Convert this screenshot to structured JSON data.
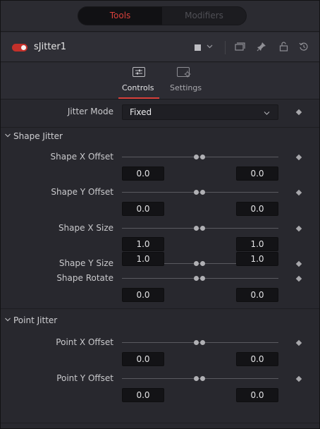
{
  "tabs": {
    "tools": "Tools",
    "modifiers": "Modifiers"
  },
  "node": {
    "name": "sJitter1",
    "toggle_color": "#c3302a"
  },
  "header_icons": [
    "color-square-icon",
    "chevron-down-icon",
    "version-icon",
    "pin-icon",
    "lock-icon",
    "reset-icon"
  ],
  "inspector_tabs": [
    {
      "label": "Controls",
      "active": true
    },
    {
      "label": "Settings",
      "active": false
    }
  ],
  "jitter_mode": {
    "label": "Jitter Mode",
    "value": "Fixed"
  },
  "sections": [
    {
      "title": "Shape Jitter",
      "controls": [
        {
          "label": "Shape X Offset",
          "left": "0.0",
          "right": "0.0"
        },
        {
          "label": "Shape Y Offset",
          "left": "0.0",
          "right": "0.0"
        },
        {
          "label": "Shape X Size",
          "left": "1.0",
          "right": "1.0"
        },
        {
          "label": "Shape Y Size",
          "left": "1.0",
          "right": "1.0"
        },
        {
          "label": "Shape Rotate",
          "left": "0.0",
          "right": "0.0"
        }
      ]
    },
    {
      "title": "Point Jitter",
      "controls": [
        {
          "label": "Point X Offset",
          "left": "0.0",
          "right": "0.0"
        },
        {
          "label": "Point Y Offset",
          "left": "0.0",
          "right": "0.0"
        }
      ]
    }
  ],
  "accent_color": "#d9413b"
}
